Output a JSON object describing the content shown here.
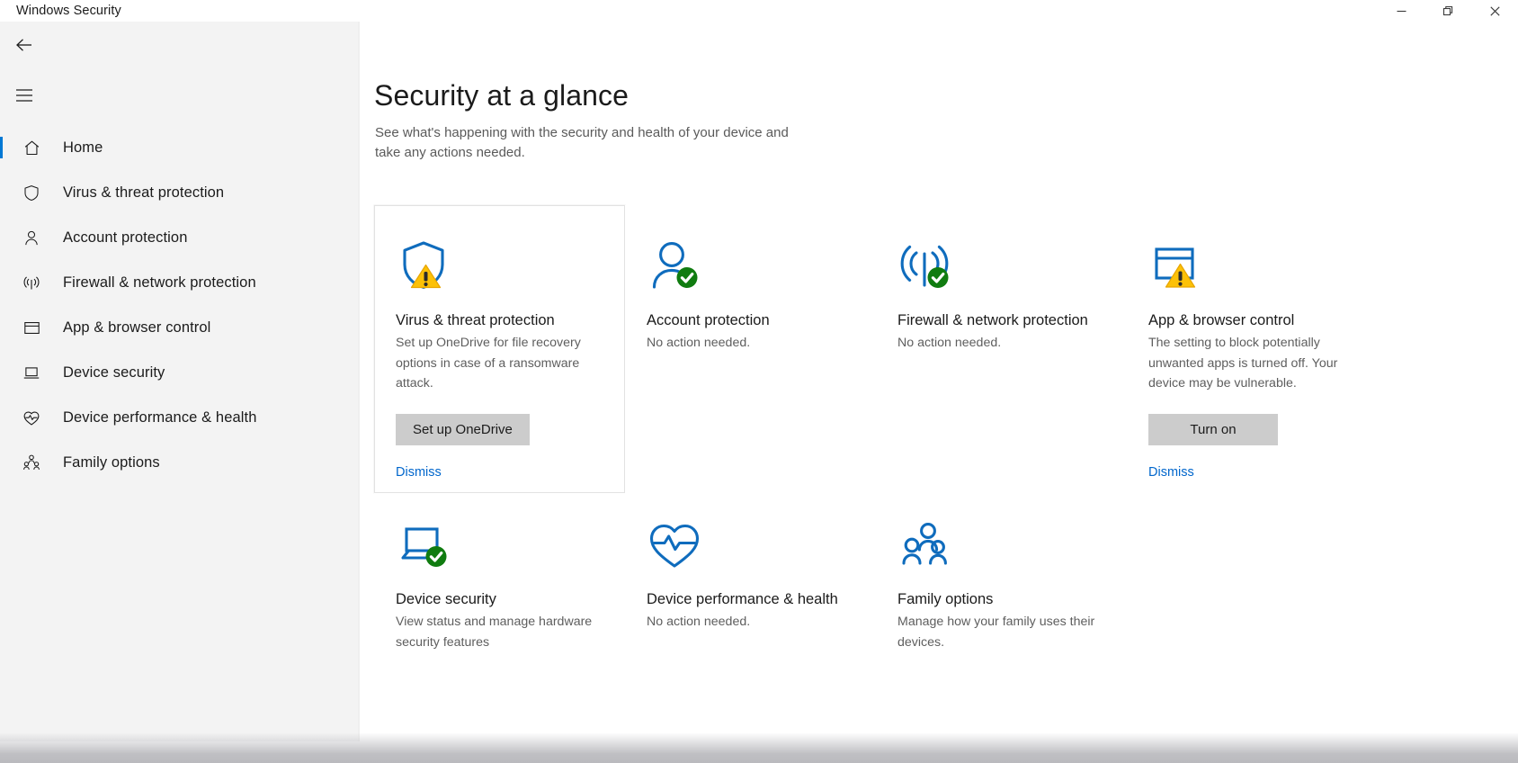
{
  "window": {
    "title": "Windows Security",
    "controls": [
      {
        "name": "minimize",
        "label": "Minimize"
      },
      {
        "name": "restore",
        "label": "Restore"
      },
      {
        "name": "close",
        "label": "Close"
      }
    ]
  },
  "sidebar": {
    "back_label": "Back",
    "menu_label": "Navigation menu",
    "items": [
      {
        "label": "Home",
        "icon": "home-icon",
        "active": true
      },
      {
        "label": "Virus & threat protection",
        "icon": "shield-icon",
        "active": false
      },
      {
        "label": "Account protection",
        "icon": "person-icon",
        "active": false
      },
      {
        "label": "Firewall & network protection",
        "icon": "network-icon",
        "active": false
      },
      {
        "label": "App & browser control",
        "icon": "window-icon",
        "active": false
      },
      {
        "label": "Device security",
        "icon": "laptop-icon",
        "active": false
      },
      {
        "label": "Device performance & health",
        "icon": "heart-pulse-icon",
        "active": false
      },
      {
        "label": "Family options",
        "icon": "family-icon",
        "active": false
      }
    ]
  },
  "main": {
    "title": "Security at a glance",
    "subtitle": "See what's happening with the security and health of your device and take any actions needed.",
    "cards": [
      {
        "id": "virus-threat-protection",
        "title": "Virus & threat protection",
        "desc": "Set up OneDrive for file recovery options in case of a ransomware attack.",
        "icon": "shield-icon",
        "status": "warning",
        "button": "Set up OneDrive",
        "link": "Dismiss",
        "selected": true
      },
      {
        "id": "account-protection",
        "title": "Account protection",
        "desc": "No action needed.",
        "icon": "person-icon",
        "status": "ok",
        "button": "",
        "link": "",
        "selected": false
      },
      {
        "id": "firewall-network-protection",
        "title": "Firewall & network protection",
        "desc": "No action needed.",
        "icon": "network-icon",
        "status": "ok",
        "button": "",
        "link": "",
        "selected": false
      },
      {
        "id": "app-browser-control",
        "title": "App & browser control",
        "desc": "The setting to block potentially unwanted apps is turned off. Your device may be vulnerable.",
        "icon": "window-icon",
        "status": "warning",
        "button": "Turn on",
        "link": "Dismiss",
        "selected": false
      },
      {
        "id": "device-security",
        "title": "Device security",
        "desc": "View status and manage hardware security features",
        "icon": "laptop-icon",
        "status": "ok",
        "button": "",
        "link": "",
        "selected": false
      },
      {
        "id": "device-performance-health",
        "title": "Device performance & health",
        "desc": "No action needed.",
        "icon": "heart-pulse-icon",
        "status": "none",
        "button": "",
        "link": "",
        "selected": false
      },
      {
        "id": "family-options",
        "title": "Family options",
        "desc": "Manage how your family uses their devices.",
        "icon": "family-icon",
        "status": "none",
        "button": "",
        "link": "",
        "selected": false
      }
    ]
  },
  "colors": {
    "accent": "#0078d4",
    "icon_blue": "#0f6cbd",
    "status_ok_green": "#107c10",
    "status_warning_yellow": "#fcc107",
    "link_blue": "#0066cc",
    "sidebar_bg": "#f3f3f3",
    "button_bg": "#cccccc"
  }
}
